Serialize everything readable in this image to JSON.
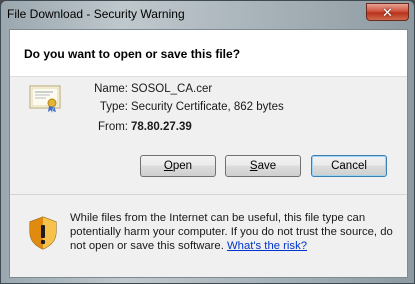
{
  "window": {
    "title": "File Download - Security Warning",
    "close_glyph": "✕"
  },
  "header": {
    "question": "Do you want to open or save this file?"
  },
  "file": {
    "name_label": "Name:",
    "name_value": "SOSOL_CA.cer",
    "type_label": "Type:",
    "type_value": "Security Certificate, 862 bytes",
    "from_label": "From:",
    "from_value": "78.80.27.39",
    "icon": "certificate-icon"
  },
  "buttons": {
    "open_mn": "O",
    "open_rest": "pen",
    "save_mn": "S",
    "save_rest": "ave",
    "cancel": "Cancel"
  },
  "warning": {
    "icon": "shield-warning-icon",
    "text": "While files from the Internet can be useful, this file type can potentially harm your computer. If you do not trust the source, do not open or save this software. ",
    "link": "What's the risk?"
  },
  "colors": {
    "link": "#0033cc",
    "close_button": "#c8432b",
    "default_button_border": "#3c7fb1"
  }
}
